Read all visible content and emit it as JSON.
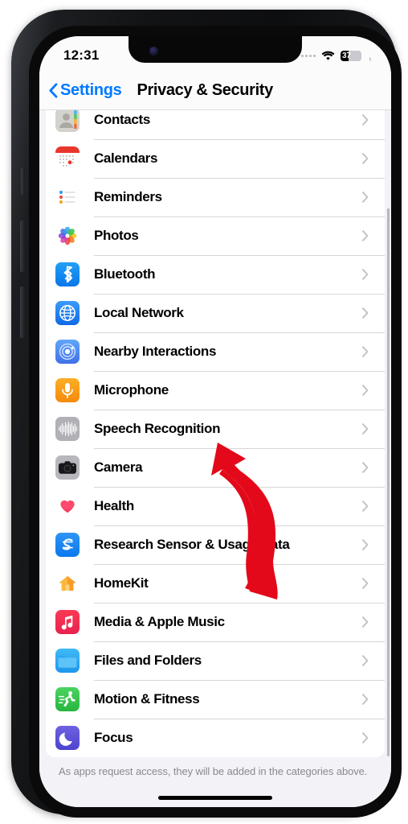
{
  "status": {
    "time": "12:31",
    "battery_percent": "37",
    "battery_level": 37,
    "wifi_icon": "wifi-icon",
    "signal_icon": "signal-dots-icon",
    "battery_icon": "battery-icon"
  },
  "nav": {
    "back_label": "Settings",
    "back_icon": "chevron-left-icon",
    "title": "Privacy & Security"
  },
  "list": {
    "items": [
      {
        "label": "Contacts",
        "icon": "contacts-icon",
        "icon_class": "ic-contacts",
        "art": "contacts",
        "chevron": "chevron-right-icon"
      },
      {
        "label": "Calendars",
        "icon": "calendars-icon",
        "icon_class": "ic-calendars",
        "art": "calendar",
        "chevron": "chevron-right-icon"
      },
      {
        "label": "Reminders",
        "icon": "reminders-icon",
        "icon_class": "ic-reminders",
        "art": "reminders",
        "chevron": "chevron-right-icon"
      },
      {
        "label": "Photos",
        "icon": "photos-icon",
        "icon_class": "ic-photos",
        "art": "photos",
        "chevron": "chevron-right-icon"
      },
      {
        "label": "Bluetooth",
        "icon": "bluetooth-icon",
        "icon_class": "ic-bluetooth",
        "art": "bluetooth",
        "chevron": "chevron-right-icon"
      },
      {
        "label": "Local Network",
        "icon": "local-network-icon",
        "icon_class": "ic-localnet",
        "art": "globe",
        "chevron": "chevron-right-icon"
      },
      {
        "label": "Nearby Interactions",
        "icon": "nearby-interactions-icon",
        "icon_class": "ic-nearby",
        "art": "radar",
        "chevron": "chevron-right-icon"
      },
      {
        "label": "Microphone",
        "icon": "microphone-icon",
        "icon_class": "ic-microphone",
        "art": "mic",
        "chevron": "chevron-right-icon"
      },
      {
        "label": "Speech Recognition",
        "icon": "speech-recognition-icon",
        "icon_class": "ic-speech",
        "art": "waveform",
        "chevron": "chevron-right-icon"
      },
      {
        "label": "Camera",
        "icon": "camera-icon",
        "icon_class": "ic-camera",
        "art": "camera",
        "chevron": "chevron-right-icon"
      },
      {
        "label": "Health",
        "icon": "health-icon",
        "icon_class": "ic-health",
        "art": "heart",
        "chevron": "chevron-right-icon"
      },
      {
        "label": "Research Sensor & Usage Data",
        "icon": "research-sensor-icon",
        "icon_class": "ic-research",
        "art": "research",
        "chevron": "chevron-right-icon"
      },
      {
        "label": "HomeKit",
        "icon": "homekit-icon",
        "icon_class": "ic-homekit",
        "art": "house",
        "chevron": "chevron-right-icon"
      },
      {
        "label": "Media & Apple Music",
        "icon": "media-apple-music-icon",
        "icon_class": "ic-media",
        "art": "music",
        "chevron": "chevron-right-icon"
      },
      {
        "label": "Files and Folders",
        "icon": "files-and-folders-icon",
        "icon_class": "ic-files",
        "art": "folder",
        "chevron": "chevron-right-icon"
      },
      {
        "label": "Motion & Fitness",
        "icon": "motion-fitness-icon",
        "icon_class": "ic-motion",
        "art": "runner",
        "chevron": "chevron-right-icon"
      },
      {
        "label": "Focus",
        "icon": "focus-icon",
        "icon_class": "ic-focus",
        "art": "moon",
        "chevron": "chevron-right-icon"
      }
    ],
    "footnote": "As apps request access, they will be added in the categories above."
  },
  "annotation": {
    "arrow_icon": "red-curved-arrow-annotation",
    "arrow_color": "#e3091a",
    "points_at": "Camera"
  },
  "colors": {
    "accent": "#007aff",
    "background": "#f2f2f7",
    "card": "#ffffff",
    "separator": "#d6d6da",
    "footnote_text": "#8a8a8e"
  }
}
